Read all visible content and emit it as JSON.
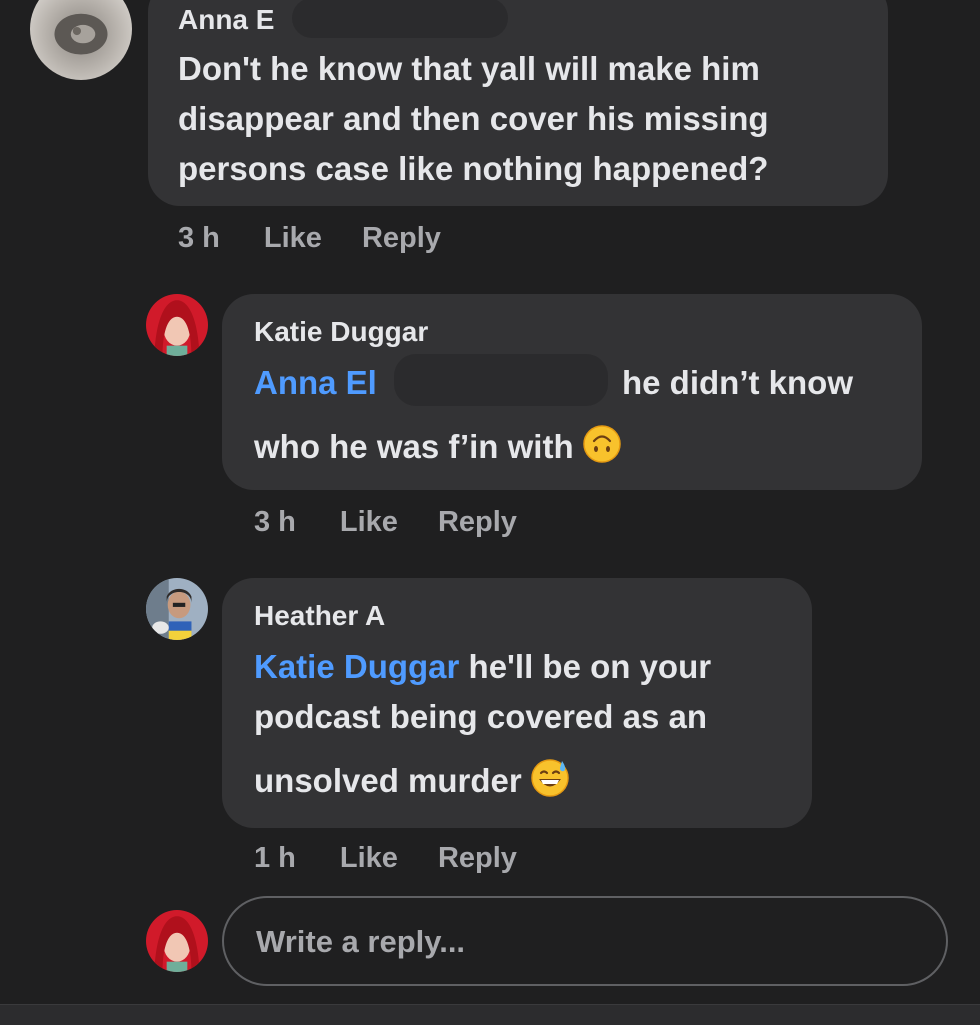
{
  "comment1": {
    "author": "Anna E",
    "lines": [
      "Don't he know that yall will make him",
      "disappear and then cover his missing",
      "persons case like nothing happened?"
    ],
    "time": "3 h",
    "like": "Like",
    "reply": "Reply"
  },
  "comment2": {
    "author": "Katie Duggar",
    "mention": "Anna El",
    "line1_rest": "he didn’t know",
    "line2": "who he was f’in with",
    "emoji_icon": "upside-down-face-icon",
    "time": "3 h",
    "like": "Like",
    "reply": "Reply"
  },
  "comment3": {
    "author": "Heather A",
    "mention": "Katie Duggar",
    "line1_rest": "he'll be on your",
    "line2": "podcast being covered as an",
    "line3": "unsolved murder",
    "emoji_icon": "grinning-sweat-icon",
    "time": "1 h",
    "like": "Like",
    "reply": "Reply"
  },
  "reply_box": {
    "placeholder": "Write a reply..."
  },
  "colors": {
    "background": "#1f1f20",
    "bubble": "#333335",
    "mention": "#4f9bff",
    "muted": "#a8a9ad"
  }
}
